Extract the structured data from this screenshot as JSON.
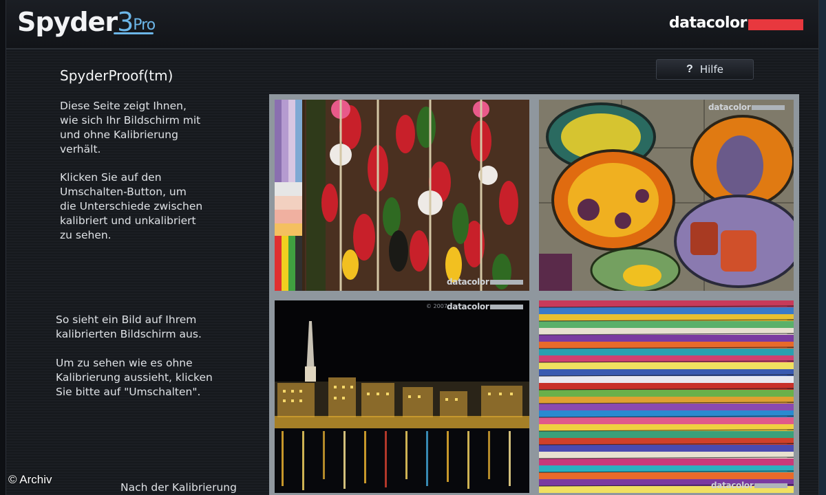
{
  "app": {
    "name": "Spyder",
    "version_num": "3",
    "edition": "Pro",
    "brand": "datacolor"
  },
  "page": {
    "title": "SpyderProof(tm)",
    "help_label": "Hilfe",
    "help_icon": "?",
    "paragraphs": [
      "Diese Seite zeigt Ihnen,\nwie sich Ihr Bildschirm mit\nund ohne Kalibrierung\nverhält.",
      "Klicken Sie auf den\nUmschalten-Button, um\ndie Unterschiede zwischen\nkalibriert und unkalibriert\nzu sehen.",
      "So sieht ein Bild auf Ihrem\nkalibrierten Bildschirm aus.",
      "Um zu sehen wie es ohne\nKalibrierung aussieht, klicken\nSie bitte auf \"Umschalten\"."
    ],
    "footer_label": "Nach der Kalibrierung"
  },
  "gallery": {
    "watermark": "datacolor",
    "copyright": "© 2007",
    "tiles": [
      "peppers",
      "ceramic-plates",
      "night-city",
      "textiles"
    ]
  },
  "credit": "© Archiv",
  "colors": {
    "accent": "#6cb6e8",
    "brand_red": "#e8383e",
    "background": "#14171c",
    "frame": "#8f979e"
  }
}
